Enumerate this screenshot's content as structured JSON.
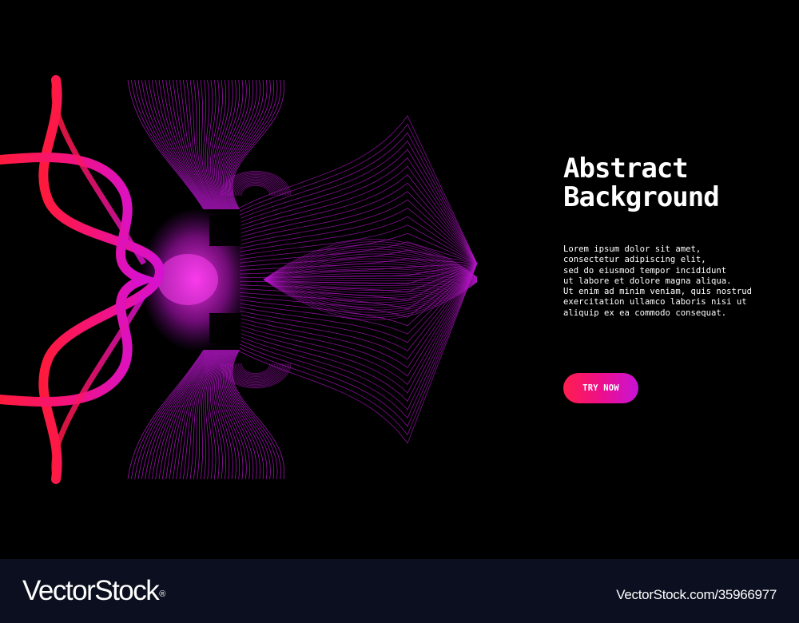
{
  "hero": {
    "title_line1": "Abstract",
    "title_line2": "Background",
    "body_lines": [
      "Lorem ipsum dolor sit amet,",
      "consectetur adipiscing elit,",
      "sed do eiusmod tempor incididunt",
      "ut labore et dolore magna aliqua.",
      "Ut enim ad minim veniam, quis nostrud",
      "exercitation ullamco laboris nisi ut",
      "aliquip ex ea commodo consequat."
    ],
    "cta_label": "TRY NOW"
  },
  "footer": {
    "brand_name": "VectorStock",
    "brand_mark": "®",
    "image_id": "VectorStock.com/35966977"
  },
  "colors": {
    "background": "#000000",
    "footer_background": "#0b0f1f",
    "gradient_red": "#ff1e4d",
    "gradient_pink": "#ee0f8a",
    "gradient_purple": "#c713d8",
    "line_art": "#b516c8",
    "text": "#ffffff"
  },
  "icons": {
    "artwork": "abstract-wave-lines-graphic"
  }
}
